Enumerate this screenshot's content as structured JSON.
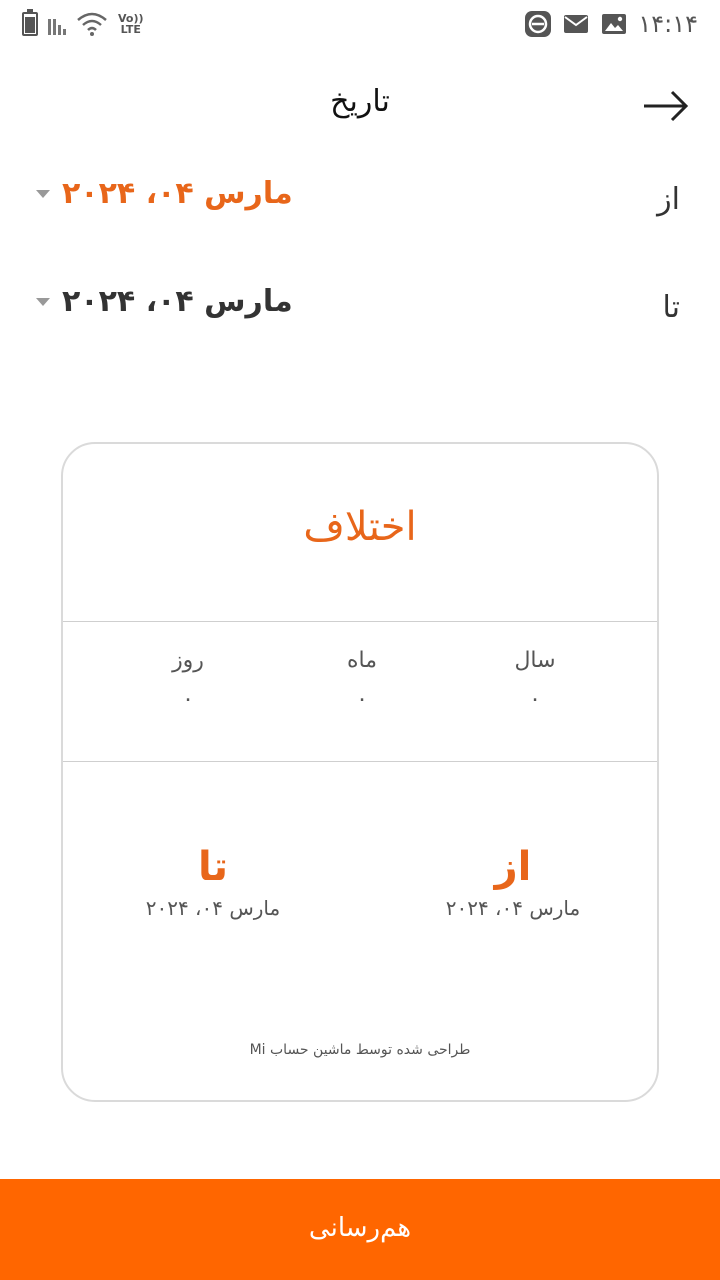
{
  "status_bar": {
    "time": "۱۴:۱۴",
    "network_label_top": "Vo))",
    "network_label_bottom": "LTE",
    "left_icons": [
      "battery-icon",
      "signal-icon",
      "wifi-icon",
      "volte-icon"
    ],
    "right_icons": [
      "app-e-icon",
      "mail-icon",
      "image-icon"
    ]
  },
  "header": {
    "title": "تاریخ",
    "back_icon": "arrow-right-icon"
  },
  "date_rows": {
    "from": {
      "label": "از",
      "value": "مارس ۰۴، ۲۰۲۴"
    },
    "to": {
      "label": "تا",
      "value": "مارس ۰۴، ۲۰۲۴"
    }
  },
  "result_card": {
    "title": "اختلاف",
    "stats": [
      {
        "label": "سال",
        "value": "۰"
      },
      {
        "label": "ماه",
        "value": "۰"
      },
      {
        "label": "روز",
        "value": "۰"
      }
    ],
    "from": {
      "label": "از",
      "date": "مارس ۰۴، ۲۰۲۴"
    },
    "to": {
      "label": "تا",
      "date": "مارس ۰۴، ۲۰۲۴"
    },
    "credit": "طراحی شده توسط ماشین حساب Mi"
  },
  "share_button": {
    "label": "هم‌رسانی"
  },
  "colors": {
    "accent": "#e8661a",
    "share_bar": "#ff6600",
    "card_border": "#dadada"
  }
}
